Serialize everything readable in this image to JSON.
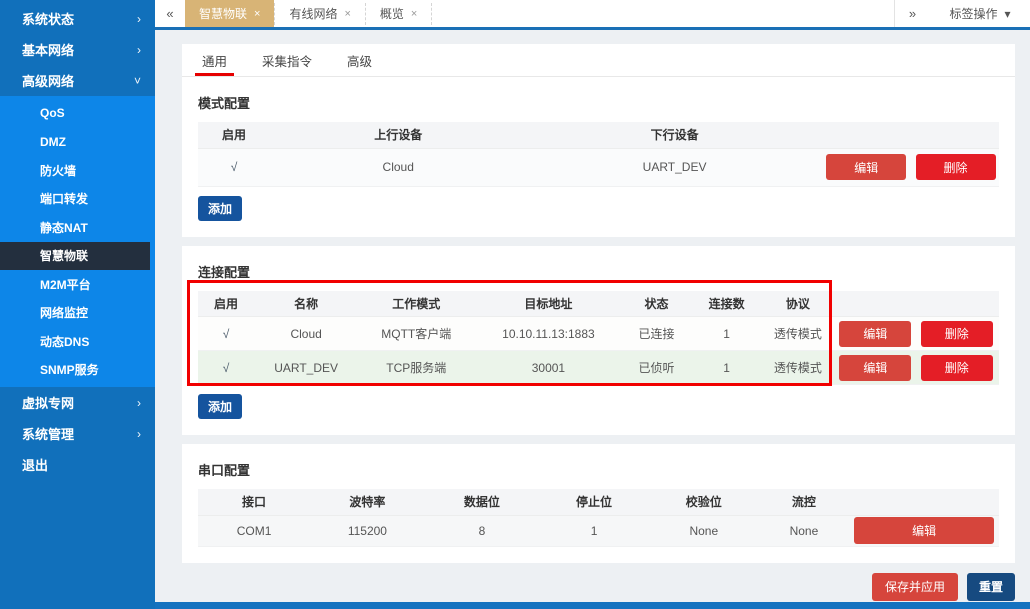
{
  "icons": {
    "scroll_left": "«",
    "scroll_right": "»",
    "chevron_right": "›",
    "chevron_down": "˅",
    "close": "×",
    "caret_down": "▾",
    "check": "√"
  },
  "sidebar": {
    "top_items": [
      {
        "label": "系统状态",
        "chevron": "›"
      },
      {
        "label": "基本网络",
        "chevron": "›"
      },
      {
        "label": "高级网络",
        "chevron": "˅"
      }
    ],
    "submenu_items": [
      "QoS",
      "DMZ",
      "防火墙",
      "端口转发",
      "静态NAT",
      "智慧物联",
      "M2M平台",
      "网络监控",
      "动态DNS",
      "SNMP服务"
    ],
    "selected_item": "智慧物联",
    "bottom_items": [
      {
        "label": "虚拟专网",
        "chevron": "›"
      },
      {
        "label": "系统管理",
        "chevron": "›"
      },
      {
        "label": "退出",
        "chevron": ""
      }
    ]
  },
  "tabbar": {
    "tabs": [
      {
        "label": "智慧物联"
      },
      {
        "label": "有线网络"
      },
      {
        "label": "概览"
      }
    ],
    "active_tab": "智慧物联",
    "menu_label": "标签操作"
  },
  "content_tabs": [
    {
      "label": "通用"
    },
    {
      "label": "采集指令"
    },
    {
      "label": "高级"
    }
  ],
  "active_content_tab": "通用",
  "sections": {
    "mode": {
      "title": "模式配置",
      "columns": [
        "启用",
        "上行设备",
        "下行设备"
      ],
      "rows": [
        {
          "enabled": "√",
          "upstream": "Cloud",
          "downstream": "UART_DEV"
        }
      ],
      "edit_label": "编辑",
      "delete_label": "删除",
      "add_label": "添加"
    },
    "connection": {
      "title": "连接配置",
      "columns": [
        "启用",
        "名称",
        "工作模式",
        "目标地址",
        "状态",
        "连接数",
        "协议"
      ],
      "rows": [
        {
          "enabled": "√",
          "name": "Cloud",
          "mode": "MQTT客户端",
          "address": "10.10.11.13:1883",
          "status": "已连接",
          "connections": "1",
          "protocol": "透传模式"
        },
        {
          "enabled": "√",
          "name": "UART_DEV",
          "mode": "TCP服务端",
          "address": "30001",
          "status": "已侦听",
          "connections": "1",
          "protocol": "透传模式"
        }
      ],
      "edit_label": "编辑",
      "delete_label": "删除",
      "add_label": "添加"
    },
    "serial": {
      "title": "串口配置",
      "columns": [
        "接口",
        "波特率",
        "数据位",
        "停止位",
        "校验位",
        "流控"
      ],
      "row": {
        "port": "COM1",
        "baud": "115200",
        "data_bits": "8",
        "stop_bits": "1",
        "parity": "None",
        "flow": "None"
      },
      "edit_label": "编辑"
    }
  },
  "footer": {
    "save_label": "保存并应用",
    "reset_label": "重置"
  },
  "colors": {
    "sidebar_blue": "#1170bb",
    "submenu_blue": "#0d86e8",
    "selected_dark": "#232f3e",
    "active_tab_tan": "#d8b476",
    "tabbar_underline": "#1a70b6",
    "content_tab_underline": "#e60000",
    "edit_red": "#d6453c",
    "delete_red": "#e41e26",
    "add_blue": "#15549e",
    "reset_navy": "#164a80",
    "highlight_red": "#f10000",
    "row_green": "#ebf4ea"
  }
}
